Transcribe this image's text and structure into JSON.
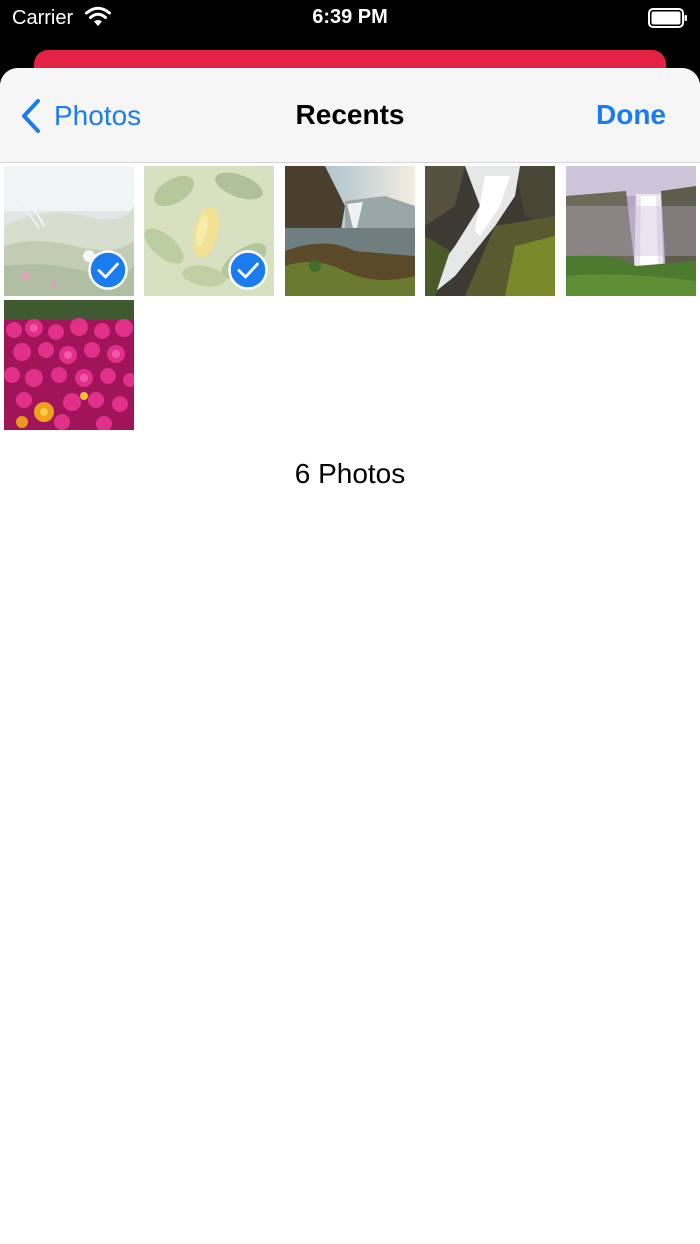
{
  "status_bar": {
    "carrier": "Carrier",
    "time": "6:39 PM",
    "wifi_icon": "wifi-icon",
    "battery_icon": "battery-full-icon"
  },
  "colors": {
    "accent": "#1a7cf0",
    "underlying_bar": "#e42243",
    "nav_background": "#f6f6f6"
  },
  "nav": {
    "back_label": "Photos",
    "back_icon": "chevron-left-icon",
    "title": "Recents",
    "done_label": "Done"
  },
  "photos": [
    {
      "subject": "grass dunes",
      "selected": true
    },
    {
      "subject": "lemon leaves",
      "selected": true
    },
    {
      "subject": "waterfall sunset",
      "selected": false
    },
    {
      "subject": "waterfall rocks",
      "selected": false
    },
    {
      "subject": "waterfall cliff",
      "selected": false
    },
    {
      "subject": "pink flowers",
      "selected": false
    }
  ],
  "footer": {
    "count_label": "6 Photos"
  }
}
